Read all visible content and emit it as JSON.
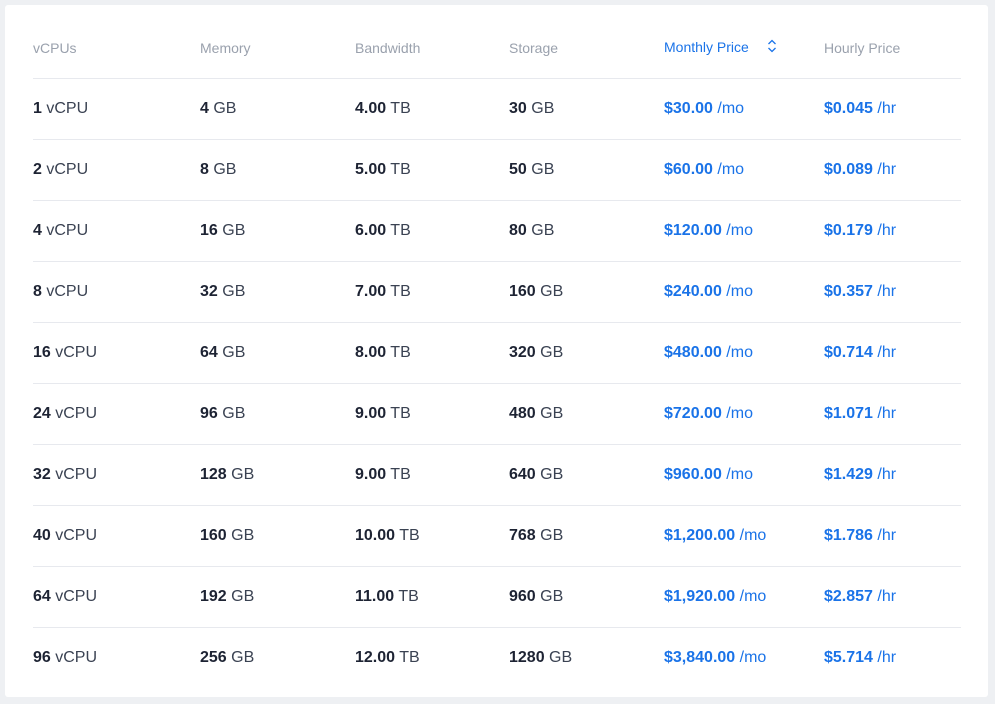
{
  "table": {
    "headers": {
      "vcpus": "vCPUs",
      "memory": "Memory",
      "bandwidth": "Bandwidth",
      "storage": "Storage",
      "monthly": "Monthly Price",
      "hourly": "Hourly Price"
    },
    "sort": {
      "column": "monthly",
      "icon": "sort-updown-icon",
      "color": "#1a73e8"
    },
    "rows": [
      {
        "vcpu": "1",
        "vcpu_unit": "vCPU",
        "mem": "4",
        "mem_unit": "GB",
        "bw": "4.00",
        "bw_unit": "TB",
        "storage": "30",
        "storage_unit": "GB",
        "monthly": "$30.00",
        "monthly_unit": "/mo",
        "hourly": "$0.045",
        "hourly_unit": "/hr"
      },
      {
        "vcpu": "2",
        "vcpu_unit": "vCPU",
        "mem": "8",
        "mem_unit": "GB",
        "bw": "5.00",
        "bw_unit": "TB",
        "storage": "50",
        "storage_unit": "GB",
        "monthly": "$60.00",
        "monthly_unit": "/mo",
        "hourly": "$0.089",
        "hourly_unit": "/hr"
      },
      {
        "vcpu": "4",
        "vcpu_unit": "vCPU",
        "mem": "16",
        "mem_unit": "GB",
        "bw": "6.00",
        "bw_unit": "TB",
        "storage": "80",
        "storage_unit": "GB",
        "monthly": "$120.00",
        "monthly_unit": "/mo",
        "hourly": "$0.179",
        "hourly_unit": "/hr"
      },
      {
        "vcpu": "8",
        "vcpu_unit": "vCPU",
        "mem": "32",
        "mem_unit": "GB",
        "bw": "7.00",
        "bw_unit": "TB",
        "storage": "160",
        "storage_unit": "GB",
        "monthly": "$240.00",
        "monthly_unit": "/mo",
        "hourly": "$0.357",
        "hourly_unit": "/hr"
      },
      {
        "vcpu": "16",
        "vcpu_unit": "vCPU",
        "mem": "64",
        "mem_unit": "GB",
        "bw": "8.00",
        "bw_unit": "TB",
        "storage": "320",
        "storage_unit": "GB",
        "monthly": "$480.00",
        "monthly_unit": "/mo",
        "hourly": "$0.714",
        "hourly_unit": "/hr"
      },
      {
        "vcpu": "24",
        "vcpu_unit": "vCPU",
        "mem": "96",
        "mem_unit": "GB",
        "bw": "9.00",
        "bw_unit": "TB",
        "storage": "480",
        "storage_unit": "GB",
        "monthly": "$720.00",
        "monthly_unit": "/mo",
        "hourly": "$1.071",
        "hourly_unit": "/hr"
      },
      {
        "vcpu": "32",
        "vcpu_unit": "vCPU",
        "mem": "128",
        "mem_unit": "GB",
        "bw": "9.00",
        "bw_unit": "TB",
        "storage": "640",
        "storage_unit": "GB",
        "monthly": "$960.00",
        "monthly_unit": "/mo",
        "hourly": "$1.429",
        "hourly_unit": "/hr"
      },
      {
        "vcpu": "40",
        "vcpu_unit": "vCPU",
        "mem": "160",
        "mem_unit": "GB",
        "bw": "10.00",
        "bw_unit": "TB",
        "storage": "768",
        "storage_unit": "GB",
        "monthly": "$1,200.00",
        "monthly_unit": "/mo",
        "hourly": "$1.786",
        "hourly_unit": "/hr"
      },
      {
        "vcpu": "64",
        "vcpu_unit": "vCPU",
        "mem": "192",
        "mem_unit": "GB",
        "bw": "11.00",
        "bw_unit": "TB",
        "storage": "960",
        "storage_unit": "GB",
        "monthly": "$1,920.00",
        "monthly_unit": "/mo",
        "hourly": "$2.857",
        "hourly_unit": "/hr"
      },
      {
        "vcpu": "96",
        "vcpu_unit": "vCPU",
        "mem": "256",
        "mem_unit": "GB",
        "bw": "12.00",
        "bw_unit": "TB",
        "storage": "1280",
        "storage_unit": "GB",
        "monthly": "$3,840.00",
        "monthly_unit": "/mo",
        "hourly": "$5.714",
        "hourly_unit": "/hr"
      }
    ]
  }
}
